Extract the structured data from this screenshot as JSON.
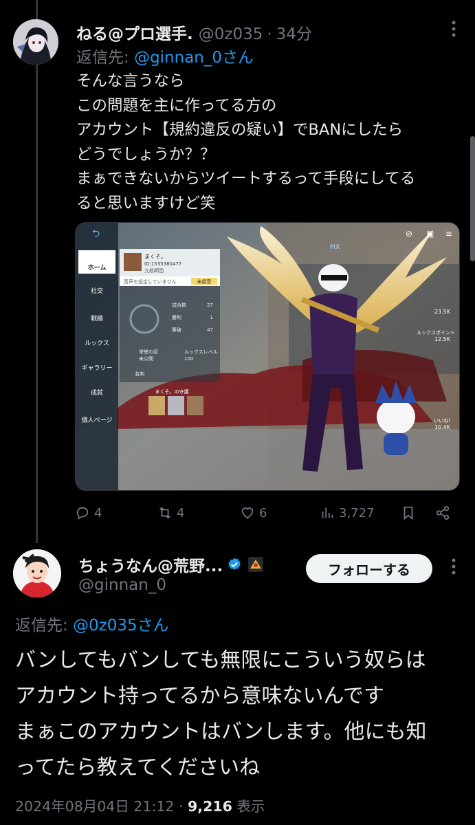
{
  "tweet1": {
    "display_name": "ねる@プロ選手.",
    "handle": "@0z035",
    "separator": "·",
    "time": "34分",
    "more_icon": "more-dots-icon",
    "reply_prefix": "返信先:",
    "reply_handle": "@ginnan_0さん",
    "lines": [
      "そんな言うなら",
      "この問題を主に作ってる方の",
      "アカウント【規約違反の疑い】でBANにしたら",
      "どうでしょうか？？",
      "まぁできないからツイートするって手段にしてる",
      "ると思いますけど笑"
    ],
    "media": {
      "alt": "game screenshot",
      "menu": [
        "ホーム",
        "社交",
        "戦績",
        "ルックス",
        "ギャラリー",
        "成就",
        "個人ページ"
      ],
      "profile_name": "まくそ。",
      "profile_id": "ID:1535380477",
      "profile_sub": "九段師団",
      "voice_hint": "音声を設定していません",
      "voice_button": "未録音",
      "stats": [
        {
          "label": "試合数",
          "value": "27"
        },
        {
          "label": "勝利",
          "value": "1"
        },
        {
          "label": "撃破",
          "value": "47"
        }
      ],
      "honor_label": "栄誉の証",
      "honor_value": "未公開",
      "looks_label": "ルックスレベル",
      "looks_value": "100",
      "card_label": "名刺",
      "guard_label": "まくそ。の守護",
      "right_stats": [
        {
          "label": "",
          "value": "23.5K"
        },
        {
          "label": "ルックスポイント",
          "value": "12.5K"
        },
        {
          "label": "いいね!",
          "value": "10.4K"
        }
      ]
    },
    "actions": {
      "reply": "4",
      "retweet": "4",
      "like": "6",
      "views": "3,727"
    }
  },
  "tweet2": {
    "display_name": "ちょうなん@荒野...",
    "handle": "@ginnan_0",
    "follow_label": "フォローする",
    "reply_prefix": "返信先:",
    "reply_handle": "@0z035さん",
    "lines": [
      "バンしてもバンしても無限にこういう奴らは",
      "アカウント持ってるから意味ないんです",
      "まぁこのアカウントはバンします。他にも知",
      "ってたら教えてくださいね"
    ],
    "timestamp": "2024年08月04日 21:12",
    "separator": "·",
    "views_count": "9,216",
    "views_label": "表示"
  },
  "colors": {
    "background": "#000000",
    "text": "#e7e9ea",
    "muted": "#71767b",
    "link": "#1d9bf0",
    "verified": "#1d9bf0"
  }
}
